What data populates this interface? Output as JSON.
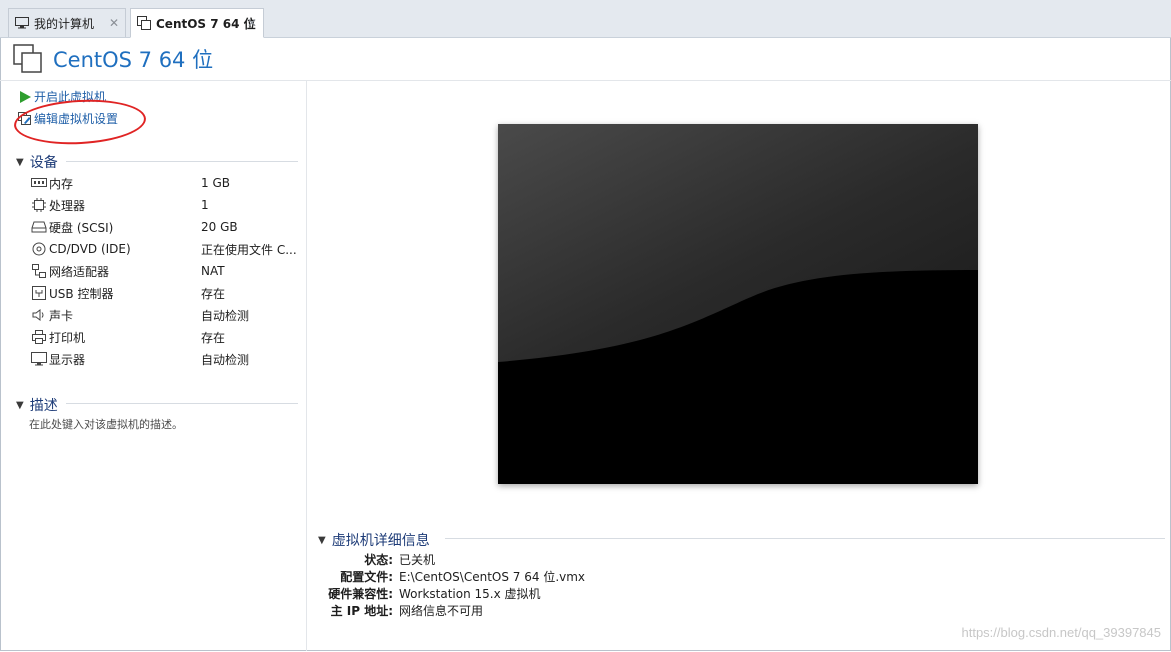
{
  "tabs": [
    {
      "label": "我的计算机",
      "icon": "monitor-icon",
      "close": "✕",
      "active": false
    },
    {
      "label": "CentOS 7 64 位",
      "icon": "vm-icon",
      "close": "✕",
      "active": true
    }
  ],
  "vm": {
    "title": "CentOS 7 64 位"
  },
  "actions": [
    {
      "label": "开启此虚拟机",
      "icon": "play-icon"
    },
    {
      "label": "编辑虚拟机设置",
      "icon": "edit-vm-icon",
      "highlighted": true
    }
  ],
  "devices_section": {
    "title": "设备"
  },
  "devices": [
    {
      "name": "内存",
      "value": "1 GB",
      "icon": "memory-icon"
    },
    {
      "name": "处理器",
      "value": "1",
      "icon": "cpu-icon"
    },
    {
      "name": "硬盘 (SCSI)",
      "value": "20 GB",
      "icon": "disk-icon"
    },
    {
      "name": "CD/DVD (IDE)",
      "value": "正在使用文件 C...",
      "icon": "cd-icon"
    },
    {
      "name": "网络适配器",
      "value": "NAT",
      "icon": "network-icon"
    },
    {
      "name": "USB 控制器",
      "value": "存在",
      "icon": "usb-icon"
    },
    {
      "name": "声卡",
      "value": "自动检测",
      "icon": "sound-icon"
    },
    {
      "name": "打印机",
      "value": "存在",
      "icon": "printer-icon"
    },
    {
      "name": "显示器",
      "value": "自动检测",
      "icon": "display-icon"
    }
  ],
  "description_section": {
    "title": "描述",
    "placeholder": "在此处键入对该虚拟机的描述。"
  },
  "details_section": {
    "title": "虚拟机详细信息"
  },
  "details": [
    {
      "key": "状态:",
      "value": "已关机"
    },
    {
      "key": "配置文件:",
      "value": "E:\\CentOS\\CentOS 7 64 位.vmx"
    },
    {
      "key": "硬件兼容性:",
      "value": "Workstation 15.x 虚拟机"
    },
    {
      "key": "主 IP 地址:",
      "value": "网络信息不可用"
    }
  ],
  "watermark": "https://blog.csdn.net/qq_39397845",
  "colors": {
    "accent": "#1f6fbf",
    "annotation": "#e02424",
    "section": "#1e3c78"
  }
}
